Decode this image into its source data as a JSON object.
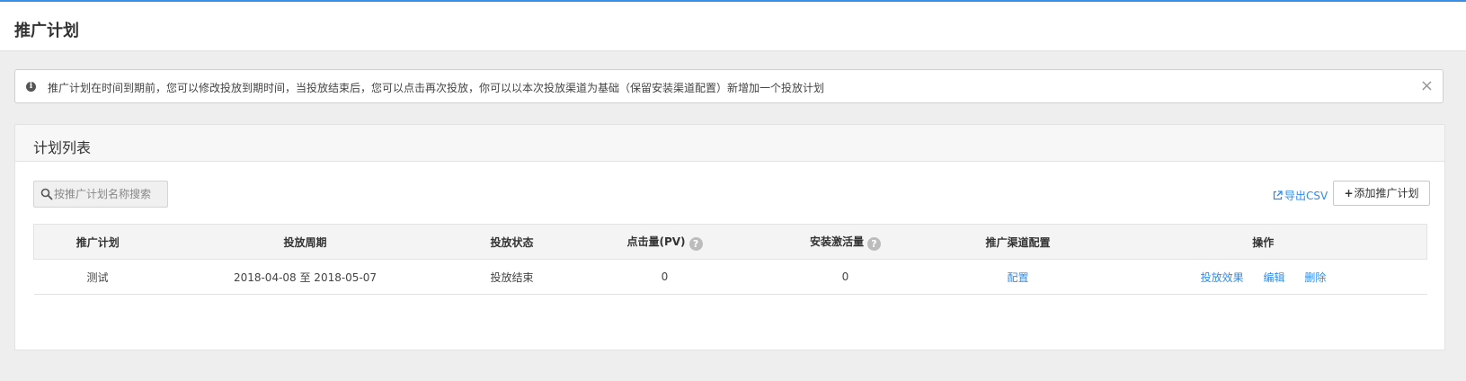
{
  "header": {
    "title": "推广计划",
    "accent_color": "#3a8ee6"
  },
  "alert": {
    "icon": "info-icon",
    "text": "推广计划在时间到期前，您可以修改投放到期时间，当投放结束后，您可以点击再次投放，你可以以本次投放渠道为基础（保留安装渠道配置）新增加一个投放计划",
    "close_label": "×"
  },
  "panel": {
    "title": "计划列表",
    "search": {
      "placeholder": "按推广计划名称搜索",
      "value": ""
    },
    "export_label": "导出CSV",
    "add_label": "添加推广计划",
    "link_color": "#2d8cf0"
  },
  "table": {
    "columns": [
      "推广计划",
      "投放周期",
      "投放状态",
      "点击量(PV)",
      "安装激活量",
      "推广渠道配置",
      "操作"
    ],
    "help_glyph": "?",
    "rows": [
      {
        "name": "测试",
        "period": "2018-04-08 至 2018-05-07",
        "status": "投放结束",
        "pv": "0",
        "installs": "0",
        "channel_config": "配置",
        "actions": [
          "投放效果",
          "编辑",
          "删除"
        ]
      }
    ]
  }
}
